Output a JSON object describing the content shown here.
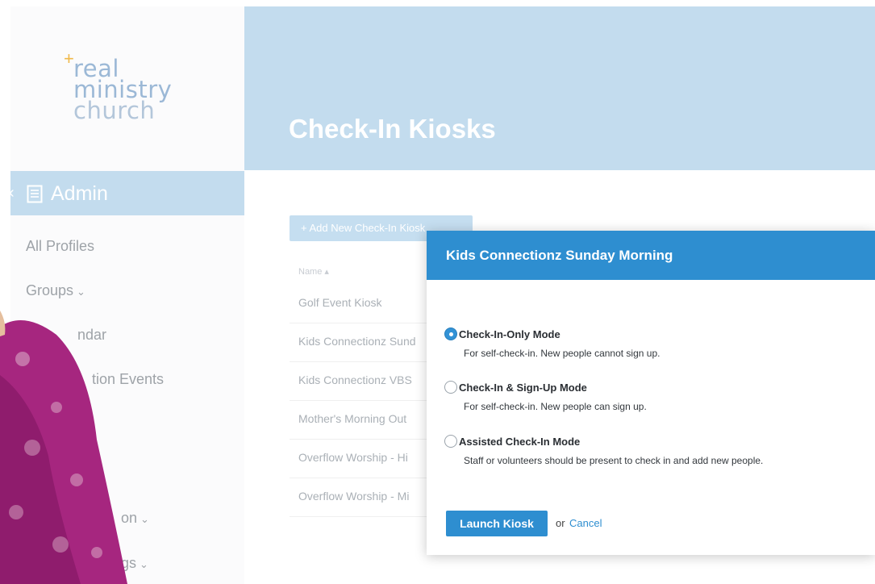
{
  "brand": {
    "logo_line1": "real",
    "logo_line2": "ministry",
    "logo_line3": "church"
  },
  "sidebar": {
    "section_label": "Admin",
    "items": [
      {
        "label": "All Profiles",
        "caret": ""
      },
      {
        "label": "Groups",
        "caret": "⌄"
      },
      {
        "label": "ndar",
        "caret": ""
      },
      {
        "label": "tion Events",
        "caret": ""
      },
      {
        "label": "on",
        "caret": "⌄"
      },
      {
        "label": "gs",
        "caret": "⌄"
      }
    ]
  },
  "page": {
    "title": "Check-In Kiosks",
    "add_button_label": "+ Add New Check-In Kiosk"
  },
  "table": {
    "column_header": "Name ▴",
    "rows": [
      "Golf Event Kiosk",
      "Kids Connectionz Sund",
      "Kids Connectionz VBS",
      "Mother's Morning Out",
      "Overflow Worship - Hi",
      "Overflow Worship - Mi"
    ]
  },
  "modal": {
    "title": "Kids Connectionz Sunday Morning",
    "options": [
      {
        "title": "Check-In-Only Mode",
        "desc": "For self-check-in. New people cannot sign up.",
        "selected": true
      },
      {
        "title": "Check-In & Sign-Up Mode",
        "desc": "For self-check-in. New people can sign up.",
        "selected": false
      },
      {
        "title": "Assisted Check-In Mode",
        "desc": "Staff or volunteers should be present to check in and add new people.",
        "selected": false
      }
    ],
    "launch_label": "Launch Kiosk",
    "or_text": "or",
    "cancel_label": "Cancel"
  },
  "colors": {
    "accent": "#2e8ed0",
    "header_bg": "#c3dcee",
    "logo": "#9bb8d6",
    "logo_plus": "#f0b94a"
  }
}
